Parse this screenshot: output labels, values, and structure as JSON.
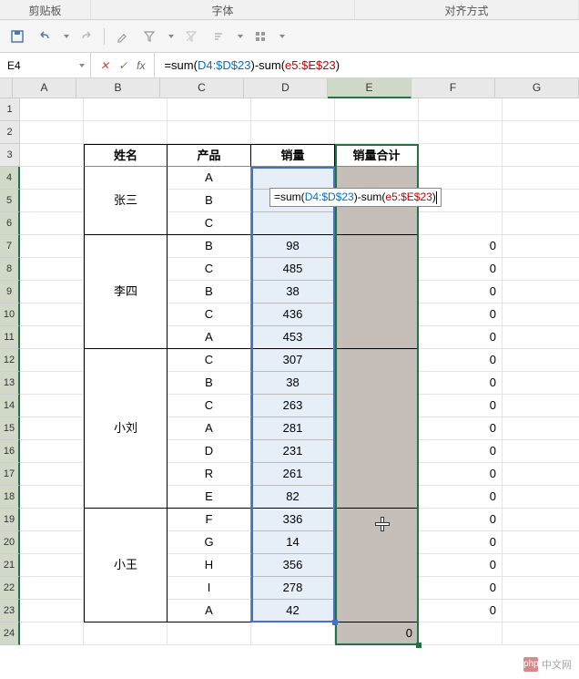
{
  "ribbon": {
    "group1": "剪贴板",
    "group2": "字体",
    "group3": "对齐方式"
  },
  "toolbar": {
    "save_icon": "save-icon",
    "undo_icon": "undo-icon",
    "redo_icon": "redo-icon",
    "brush_icon": "brush-icon",
    "funnel_icon": "funnel-icon"
  },
  "name_box": "E4",
  "formula": {
    "prefix": "=sum(",
    "ref1": "D4:$D$23",
    "mid": ")-sum(",
    "ref2": "e5:$E$23",
    "suffix": ")"
  },
  "columns": [
    "A",
    "B",
    "C",
    "D",
    "E",
    "F",
    "G"
  ],
  "headers": {
    "name": "姓名",
    "product": "产品",
    "sales": "销量",
    "total": "销量合计"
  },
  "chart_data": {
    "type": "table",
    "columns": [
      "姓名",
      "产品",
      "销量",
      "销量合计",
      "F"
    ],
    "rows": [
      {
        "name": "张三",
        "product": "A",
        "sales": "",
        "f": ""
      },
      {
        "name": "张三",
        "product": "B",
        "sales": "",
        "f": ""
      },
      {
        "name": "张三",
        "product": "C",
        "sales": "",
        "f": ""
      },
      {
        "name": "李四",
        "product": "B",
        "sales": 98,
        "f": 0
      },
      {
        "name": "李四",
        "product": "C",
        "sales": 485,
        "f": 0
      },
      {
        "name": "李四",
        "product": "B",
        "sales": 38,
        "f": 0
      },
      {
        "name": "李四",
        "product": "C",
        "sales": 436,
        "f": 0
      },
      {
        "name": "李四",
        "product": "A",
        "sales": 453,
        "f": 0
      },
      {
        "name": "小刘",
        "product": "C",
        "sales": 307,
        "f": 0
      },
      {
        "name": "小刘",
        "product": "B",
        "sales": 38,
        "f": 0
      },
      {
        "name": "小刘",
        "product": "C",
        "sales": 263,
        "f": 0
      },
      {
        "name": "小刘",
        "product": "A",
        "sales": 281,
        "f": 0
      },
      {
        "name": "小刘",
        "product": "D",
        "sales": 231,
        "f": 0
      },
      {
        "name": "小刘",
        "product": "R",
        "sales": 261,
        "f": 0
      },
      {
        "name": "小刘",
        "product": "E",
        "sales": 82,
        "f": 0
      },
      {
        "name": "小王",
        "product": "F",
        "sales": 336,
        "f": 0
      },
      {
        "name": "小王",
        "product": "G",
        "sales": 14,
        "f": 0
      },
      {
        "name": "小王",
        "product": "H",
        "sales": 356,
        "f": 0
      },
      {
        "name": "小王",
        "product": "I",
        "sales": 278,
        "f": 0
      },
      {
        "name": "小王",
        "product": "A",
        "sales": 42,
        "f": 0
      }
    ],
    "name_groups": [
      {
        "name": "张三",
        "start": 0,
        "span": 3
      },
      {
        "name": "李四",
        "start": 3,
        "span": 5
      },
      {
        "name": "小刘",
        "start": 8,
        "span": 7
      },
      {
        "name": "小王",
        "start": 15,
        "span": 5
      }
    ],
    "bottom_right": 0
  },
  "watermark": {
    "logo": "php",
    "text": "中文网"
  }
}
